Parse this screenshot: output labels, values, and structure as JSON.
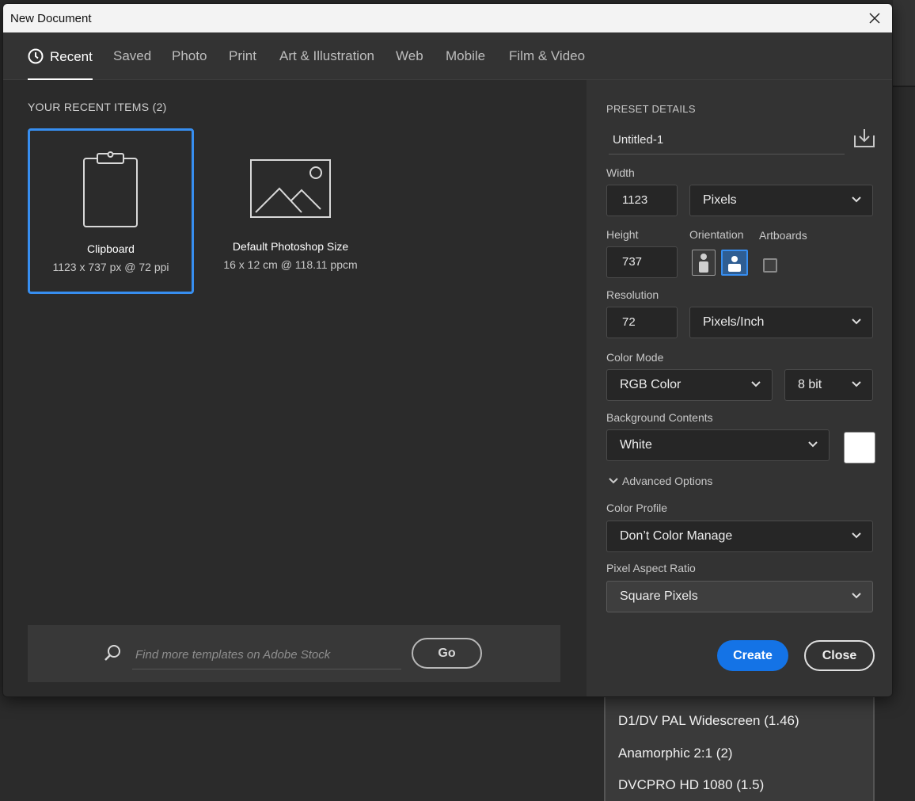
{
  "window": {
    "title": "New Document"
  },
  "tabs": [
    {
      "label": "Recent"
    },
    {
      "label": "Saved"
    },
    {
      "label": "Photo"
    },
    {
      "label": "Print"
    },
    {
      "label": "Art & Illustration"
    },
    {
      "label": "Web"
    },
    {
      "label": "Mobile"
    },
    {
      "label": "Film & Video"
    }
  ],
  "recent": {
    "title": "YOUR RECENT ITEMS  (2)",
    "items": [
      {
        "name": "Clipboard",
        "details": "1123 x 737 px @ 72 ppi"
      },
      {
        "name": "Default Photoshop Size",
        "details": "16 x 12 cm @ 118.11 ppcm"
      }
    ]
  },
  "search": {
    "placeholder": "Find more templates on Adobe Stock",
    "go_label": "Go"
  },
  "preset": {
    "section_title": "PRESET DETAILS",
    "name": "Untitled-1",
    "width_label": "Width",
    "width_value": "1123",
    "width_unit": "Pixels",
    "height_label": "Height",
    "height_value": "737",
    "orientation_label": "Orientation",
    "artboards_label": "Artboards",
    "resolution_label": "Resolution",
    "resolution_value": "72",
    "resolution_unit": "Pixels/Inch",
    "color_mode_label": "Color Mode",
    "color_mode": "RGB Color",
    "bit_depth": "8 bit",
    "background_label": "Background Contents",
    "background": "White",
    "advanced_label": "Advanced Options",
    "color_profile_label": "Color Profile",
    "color_profile": "Don’t Color Manage",
    "pixel_aspect_label": "Pixel Aspect Ratio",
    "pixel_aspect": "Square Pixels"
  },
  "buttons": {
    "create": "Create",
    "close": "Close"
  },
  "dropdown_options": [
    "D1/DV PAL Widescreen (1.46)",
    "Anamorphic 2:1 (2)",
    "DVCPRO HD 1080 (1.5)"
  ],
  "colors": {
    "accent": "#1473e6",
    "selection": "#378ef0",
    "panel": "#333333",
    "background": "#2b2b2b"
  }
}
